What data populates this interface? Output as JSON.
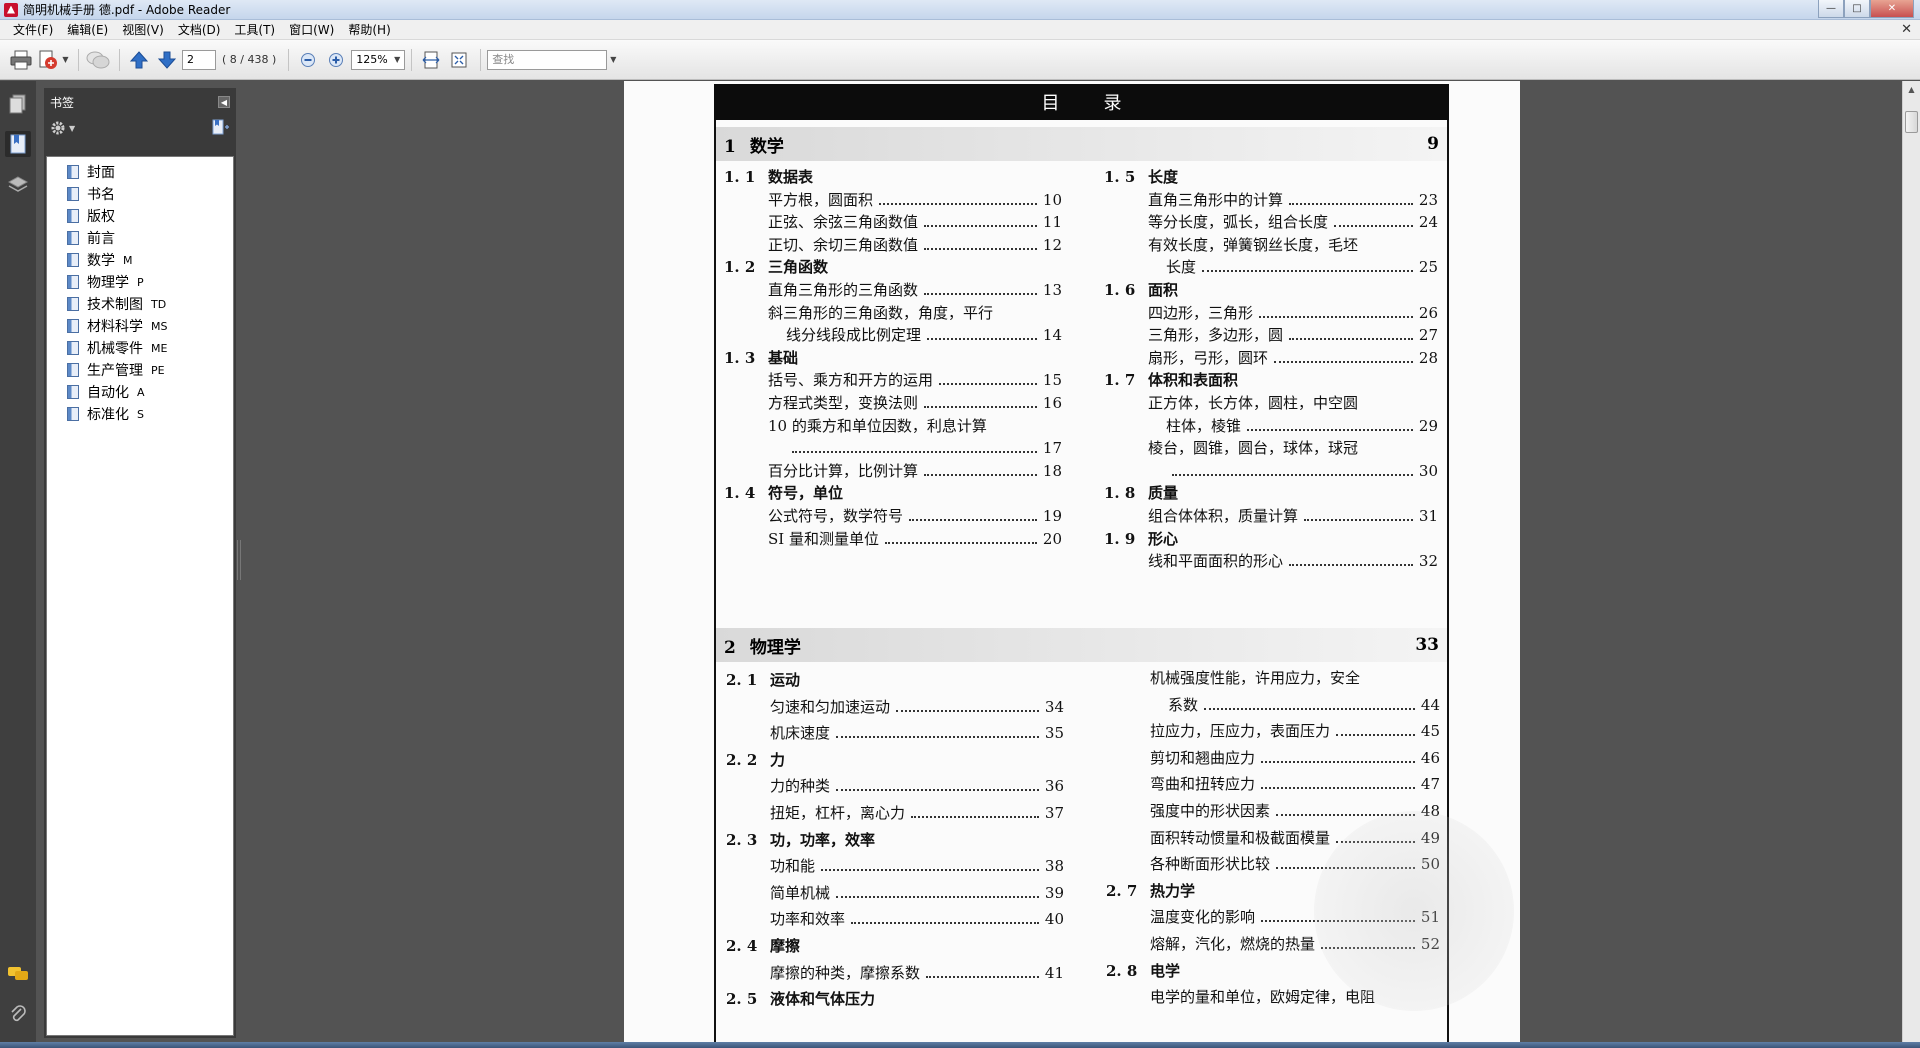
{
  "window": {
    "title": "简明机械手册 德.pdf - Adobe Reader"
  },
  "menu": [
    "文件(F)",
    "编辑(E)",
    "视图(V)",
    "文档(D)",
    "工具(T)",
    "窗口(W)",
    "帮助(H)"
  ],
  "toolbar": {
    "page_number": "2",
    "page_count": "( 8 / 438 )",
    "zoom": "125%",
    "search_placeholder": "查找"
  },
  "bookmarks": {
    "title": "书签",
    "items": [
      {
        "label": "封面",
        "code": ""
      },
      {
        "label": "书名",
        "code": ""
      },
      {
        "label": "版权",
        "code": ""
      },
      {
        "label": "前言",
        "code": ""
      },
      {
        "label": "数学",
        "code": "M"
      },
      {
        "label": "物理学",
        "code": "P"
      },
      {
        "label": "技术制图",
        "code": "TD"
      },
      {
        "label": "材料科学",
        "code": "MS"
      },
      {
        "label": "机械零件",
        "code": "ME"
      },
      {
        "label": "生产管理",
        "code": "PE"
      },
      {
        "label": "自动化",
        "code": "A"
      },
      {
        "label": "标准化",
        "code": "S"
      }
    ]
  },
  "document": {
    "header": "目录",
    "chapters": [
      {
        "num": "1",
        "title": "数学",
        "page": "9"
      },
      {
        "num": "2",
        "title": "物理学",
        "page": "33"
      }
    ],
    "ch1_left": [
      {
        "kind": "sec",
        "num": "1. 1",
        "title": "数据表"
      },
      {
        "kind": "entry",
        "title": "平方根，圆面积",
        "page": "10"
      },
      {
        "kind": "entry",
        "title": "正弦、余弦三角函数值",
        "page": "11"
      },
      {
        "kind": "entry",
        "title": "正切、余切三角函数值",
        "page": "12"
      },
      {
        "kind": "sec",
        "num": "1. 2",
        "title": "三角函数"
      },
      {
        "kind": "entry",
        "title": "直角三角形的三角函数",
        "page": "13"
      },
      {
        "kind": "cont",
        "title": "斜三角形的三角函数，角度，平行"
      },
      {
        "kind": "entry",
        "title": "线分线段成比例定理",
        "page": "14",
        "indent": true
      },
      {
        "kind": "sec",
        "num": "1. 3",
        "title": "基础"
      },
      {
        "kind": "entry",
        "title": "括号、乘方和开方的运用",
        "page": "15"
      },
      {
        "kind": "entry",
        "title": "方程式类型，变换法则",
        "page": "16"
      },
      {
        "kind": "cont",
        "title": "10 的乘方和单位因数，利息计算"
      },
      {
        "kind": "entry",
        "title": "",
        "page": "17",
        "indent": true
      },
      {
        "kind": "entry",
        "title": "百分比计算，比例计算",
        "page": "18"
      },
      {
        "kind": "sec",
        "num": "1. 4",
        "title": "符号，单位"
      },
      {
        "kind": "entry",
        "title": "公式符号，数学符号",
        "page": "19"
      },
      {
        "kind": "entry",
        "title": "SI 量和测量单位",
        "page": "20"
      }
    ],
    "ch1_right": [
      {
        "kind": "sec",
        "num": "1. 5",
        "title": "长度"
      },
      {
        "kind": "entry",
        "title": "直角三角形中的计算",
        "page": "23"
      },
      {
        "kind": "entry",
        "title": "等分长度，弧长，组合长度",
        "page": "24"
      },
      {
        "kind": "cont",
        "title": "有效长度，弹簧钢丝长度，毛坯"
      },
      {
        "kind": "entry",
        "title": "长度",
        "page": "25",
        "indent": true
      },
      {
        "kind": "sec",
        "num": "1. 6",
        "title": "面积"
      },
      {
        "kind": "entry",
        "title": "四边形，三角形",
        "page": "26"
      },
      {
        "kind": "entry",
        "title": "三角形，多边形，圆",
        "page": "27"
      },
      {
        "kind": "entry",
        "title": "扇形，弓形，圆环",
        "page": "28"
      },
      {
        "kind": "sec",
        "num": "1. 7",
        "title": "体积和表面积"
      },
      {
        "kind": "cont",
        "title": "正方体，长方体，圆柱，中空圆"
      },
      {
        "kind": "entry",
        "title": "柱体，棱锥",
        "page": "29",
        "indent": true
      },
      {
        "kind": "cont",
        "title": "棱台，圆锥，圆台，球体，球冠"
      },
      {
        "kind": "entry",
        "title": "",
        "page": "30",
        "indent": true
      },
      {
        "kind": "sec",
        "num": "1. 8",
        "title": "质量"
      },
      {
        "kind": "entry",
        "title": "组合体体积，质量计算",
        "page": "31"
      },
      {
        "kind": "sec",
        "num": "1. 9",
        "title": "形心"
      },
      {
        "kind": "entry",
        "title": "线和平面面积的形心",
        "page": "32"
      }
    ],
    "ch2_left": [
      {
        "kind": "sec",
        "num": "2. 1",
        "title": "运动"
      },
      {
        "kind": "entry",
        "title": "匀速和匀加速运动",
        "page": "34"
      },
      {
        "kind": "entry",
        "title": "机床速度",
        "page": "35"
      },
      {
        "kind": "sec",
        "num": "2. 2",
        "title": "力"
      },
      {
        "kind": "entry",
        "title": "力的种类",
        "page": "36"
      },
      {
        "kind": "entry",
        "title": "扭矩，杠杆，离心力",
        "page": "37"
      },
      {
        "kind": "sec",
        "num": "2. 3",
        "title": "功，功率，效率"
      },
      {
        "kind": "entry",
        "title": "功和能",
        "page": "38"
      },
      {
        "kind": "entry",
        "title": "简单机械",
        "page": "39"
      },
      {
        "kind": "entry",
        "title": "功率和效率",
        "page": "40"
      },
      {
        "kind": "sec",
        "num": "2. 4",
        "title": "摩擦"
      },
      {
        "kind": "entry",
        "title": "摩擦的种类，摩擦系数",
        "page": "41"
      },
      {
        "kind": "sec",
        "num": "2. 5",
        "title": "液体和气体压力"
      }
    ],
    "ch2_right": [
      {
        "kind": "cont",
        "title": "机械强度性能，许用应力，安全"
      },
      {
        "kind": "entry",
        "title": "系数",
        "page": "44",
        "indent": true
      },
      {
        "kind": "entry",
        "title": "拉应力，压应力，表面压力",
        "page": "45"
      },
      {
        "kind": "entry",
        "title": "剪切和翘曲应力",
        "page": "46"
      },
      {
        "kind": "entry",
        "title": "弯曲和扭转应力",
        "page": "47"
      },
      {
        "kind": "entry",
        "title": "强度中的形状因素",
        "page": "48"
      },
      {
        "kind": "entry",
        "title": "面积转动惯量和极截面模量",
        "page": "49"
      },
      {
        "kind": "entry",
        "title": "各种断面形状比较",
        "page": "50"
      },
      {
        "kind": "sec",
        "num": "2. 7",
        "title": "热力学"
      },
      {
        "kind": "entry",
        "title": "温度变化的影响",
        "page": "51"
      },
      {
        "kind": "entry",
        "title": "熔解，汽化，燃烧的热量",
        "page": "52"
      },
      {
        "kind": "sec",
        "num": "2. 8",
        "title": "电学"
      },
      {
        "kind": "cont",
        "title": "电学的量和单位，欧姆定律，电阻"
      }
    ]
  },
  "colors": {
    "workspace": "#535353",
    "panel": "#3a3a3a",
    "accent": "#2b5da8"
  }
}
